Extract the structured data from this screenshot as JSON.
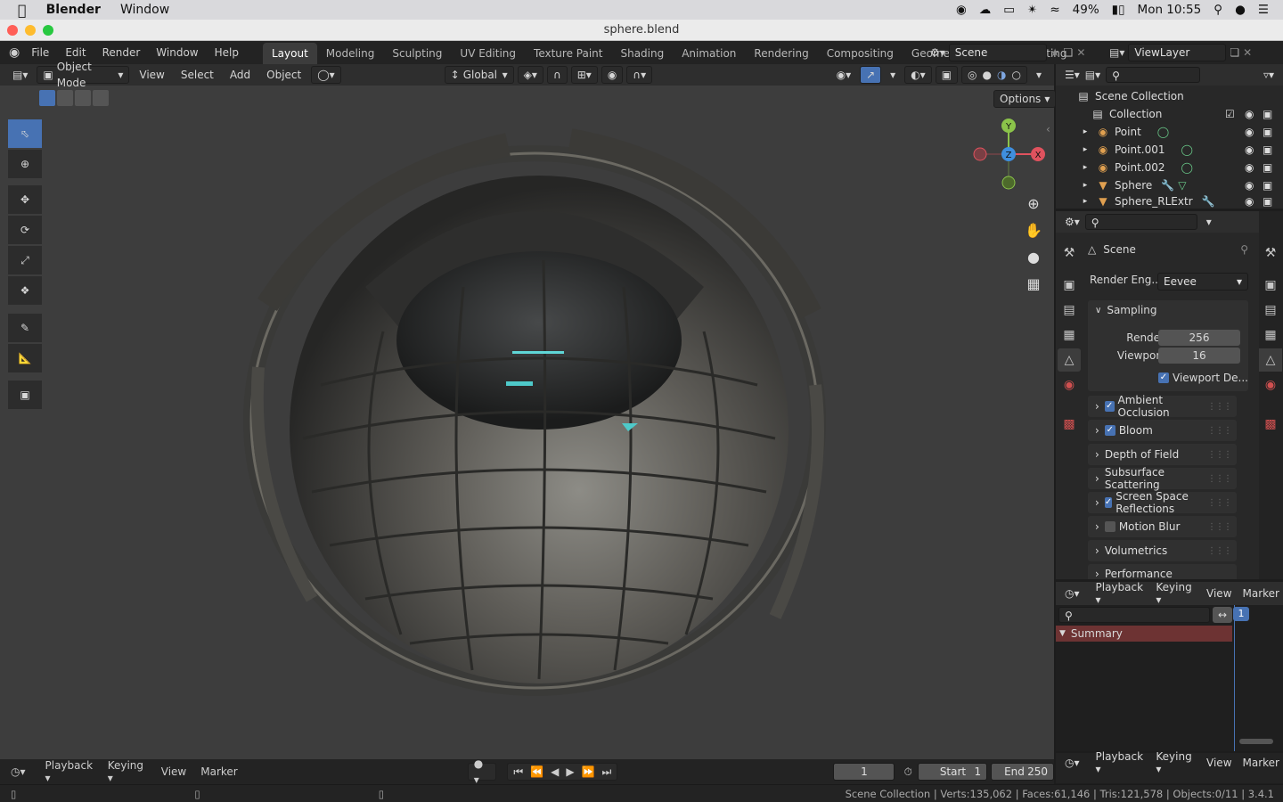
{
  "macbar": {
    "app": "Blender",
    "menu": "Window",
    "battery": "49%",
    "clock": "Mon 10:55"
  },
  "window": {
    "title": "sphere.blend"
  },
  "topbar": {
    "menu": [
      "File",
      "Edit",
      "Render",
      "Window",
      "Help"
    ],
    "workspaces": [
      "Layout",
      "Modeling",
      "Sculpting",
      "UV Editing",
      "Texture Paint",
      "Shading",
      "Animation",
      "Rendering",
      "Compositing",
      "Geometry Nodes",
      "Scripting"
    ],
    "active_workspace": "Layout",
    "scene": "Scene",
    "view_layer": "ViewLayer"
  },
  "viewport": {
    "mode": "Object Mode",
    "menu": [
      "View",
      "Select",
      "Add",
      "Object"
    ],
    "orientation": "Global",
    "options": "Options",
    "gizmo": {
      "y": "Y",
      "x": "X",
      "z": "Z"
    }
  },
  "outliner": {
    "root": "Scene Collection",
    "collection": "Collection",
    "items": [
      "Point",
      "Point.001",
      "Point.002",
      "Sphere",
      "Sphere_RLExtr"
    ]
  },
  "properties": {
    "context": "Scene",
    "render_engine_label": "Render Eng...",
    "render_engine": "Eevee",
    "sampling": "Sampling",
    "render_label": "Render",
    "render_value": "256",
    "viewport_label": "Viewport",
    "viewport_value": "16",
    "viewport_denoise": "Viewport De...",
    "sections": [
      {
        "label": "Ambient Occlusion",
        "checkbox": true,
        "checked": true
      },
      {
        "label": "Bloom",
        "checkbox": true,
        "checked": true
      },
      {
        "label": "Depth of Field",
        "checkbox": false,
        "checked": false
      },
      {
        "label": "Subsurface Scattering",
        "checkbox": false,
        "checked": false
      },
      {
        "label": "Screen Space Reflections",
        "checkbox": true,
        "checked": true
      },
      {
        "label": "Motion Blur",
        "checkbox": true,
        "checked": false
      },
      {
        "label": "Volumetrics",
        "checkbox": false,
        "checked": false
      },
      {
        "label": "Performance",
        "checkbox": false,
        "checked": false
      }
    ]
  },
  "dopesheet": {
    "menu": [
      "Playback",
      "Keying",
      "View",
      "Marker"
    ],
    "summary": "Summary",
    "frame": "1"
  },
  "timeline": {
    "menu": [
      "Playback",
      "Keying",
      "View",
      "Marker"
    ],
    "current_frame": "1",
    "start_label": "Start",
    "start": "1",
    "end_label": "End",
    "end": "250"
  },
  "status": {
    "text": "Scene Collection | Verts:135,062 | Faces:61,146 | Tris:121,578 | Objects:0/11 | 3.4.1"
  }
}
